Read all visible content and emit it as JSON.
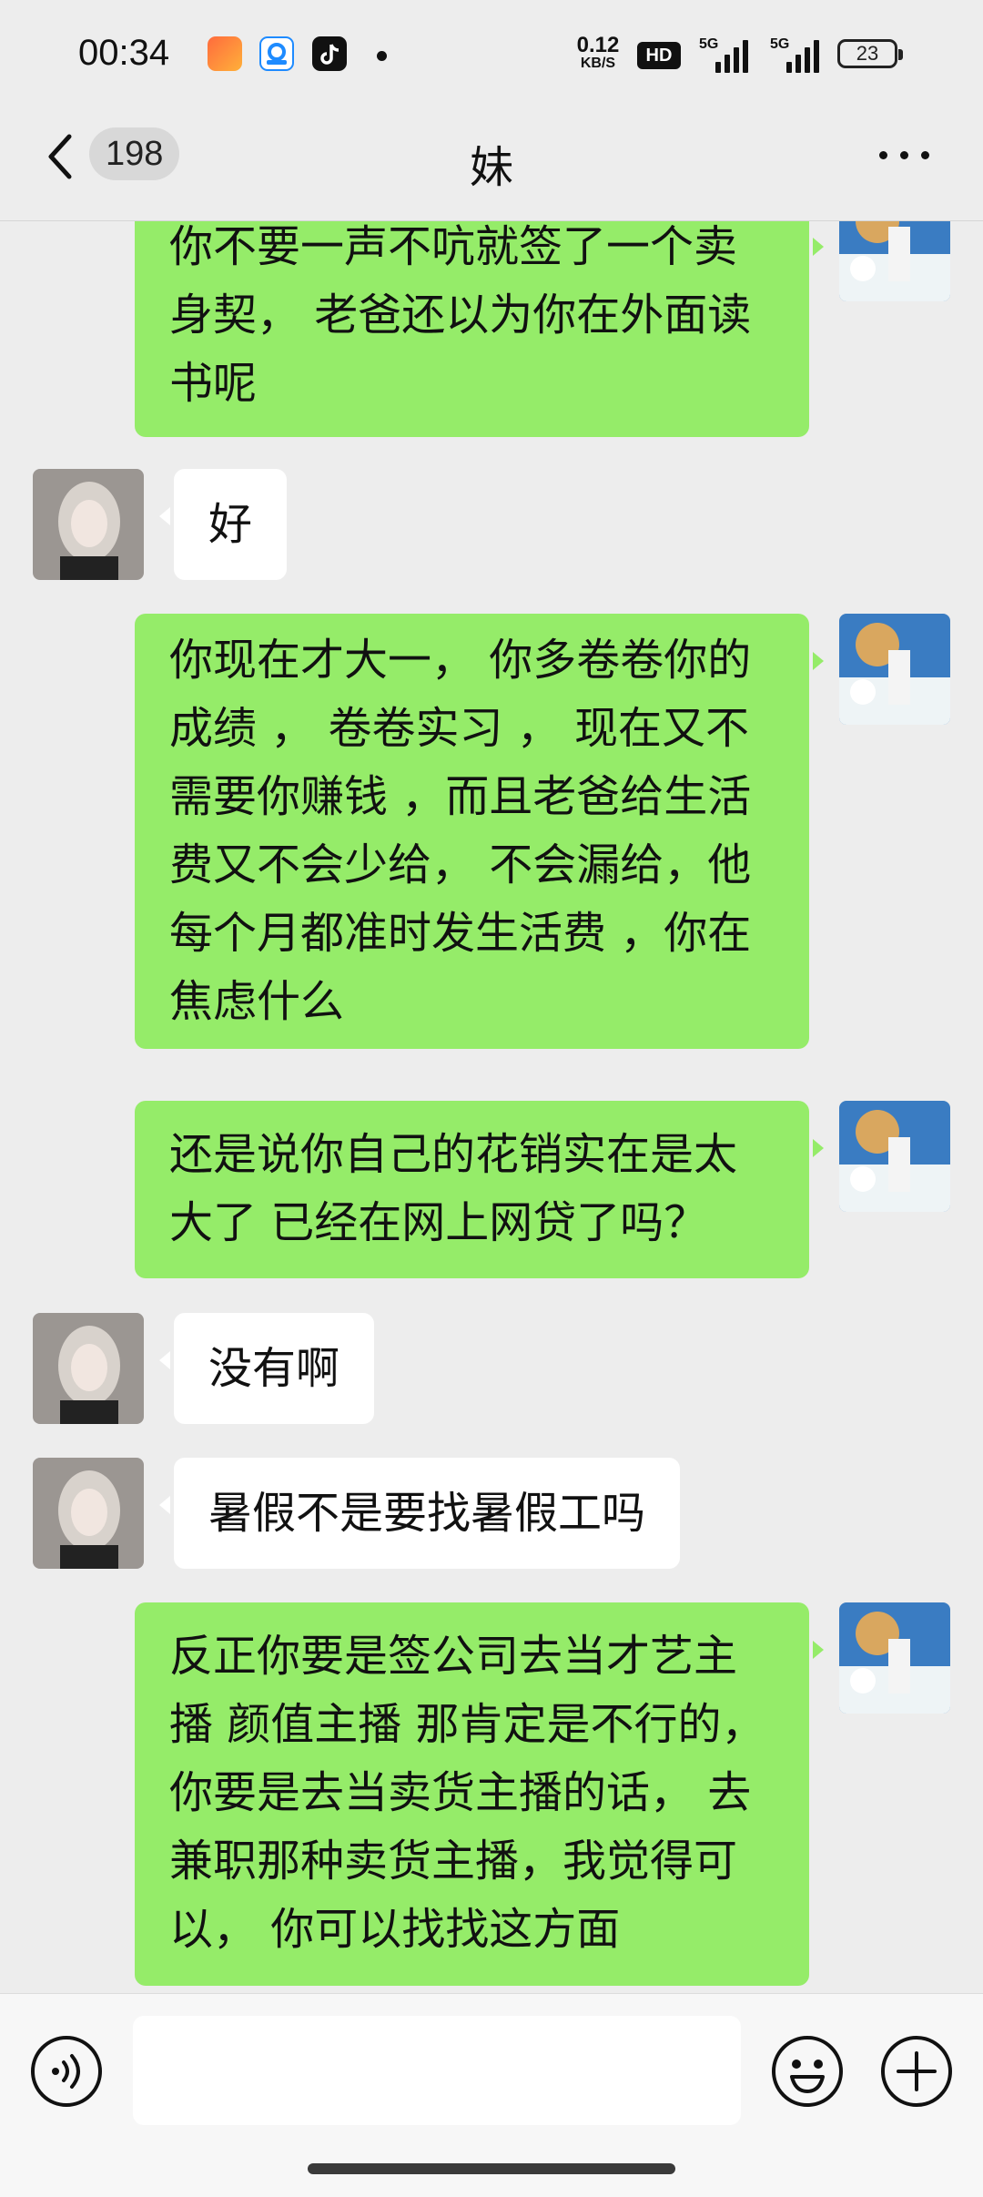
{
  "status_bar": {
    "time": "00:34",
    "net_speed_value": "0.12",
    "net_speed_unit": "KB/S",
    "hd_label": "HD",
    "signal_1_label": "5G",
    "signal_2_label": "5G",
    "battery": "23"
  },
  "nav": {
    "unread_count": "198",
    "title": "妹"
  },
  "messages": [
    {
      "sender": "me",
      "lines": [
        "你不要一声不吭就签了一个卖",
        "身契， 老爸还以为你在外面读",
        "书呢"
      ]
    },
    {
      "sender": "them",
      "lines": [
        "好"
      ]
    },
    {
      "sender": "me",
      "lines": [
        "你现在才大一， 你多卷卷你的",
        "成绩 ， 卷卷实习 ， 现在又不",
        "需要你赚钱 ，而且老爸给生活",
        "费又不会少给， 不会漏给，他",
        "每个月都准时发生活费 ，你在",
        "焦虑什么"
      ]
    },
    {
      "sender": "me",
      "lines": [
        "还是说你自己的花销实在是太",
        "大了 已经在网上网贷了吗？"
      ]
    },
    {
      "sender": "them",
      "lines": [
        "没有啊"
      ]
    },
    {
      "sender": "them",
      "lines": [
        "暑假不是要找暑假工吗"
      ]
    },
    {
      "sender": "me",
      "lines": [
        "反正你要是签公司去当才艺主",
        "播 颜值主播 那肯定是不行的，",
        "你要是去当卖货主播的话， 去",
        "兼职那种卖货主播，我觉得可",
        "以，  你可以找找这方面"
      ]
    }
  ],
  "colors": {
    "background": "#ededed",
    "my_bubble": "#95ec69",
    "their_bubble": "#ffffff"
  },
  "icons": {
    "back": "chevron-left-icon",
    "more": "more-dots-icon",
    "voice": "voice-icon",
    "emoji": "emoji-icon",
    "plus": "plus-icon"
  }
}
